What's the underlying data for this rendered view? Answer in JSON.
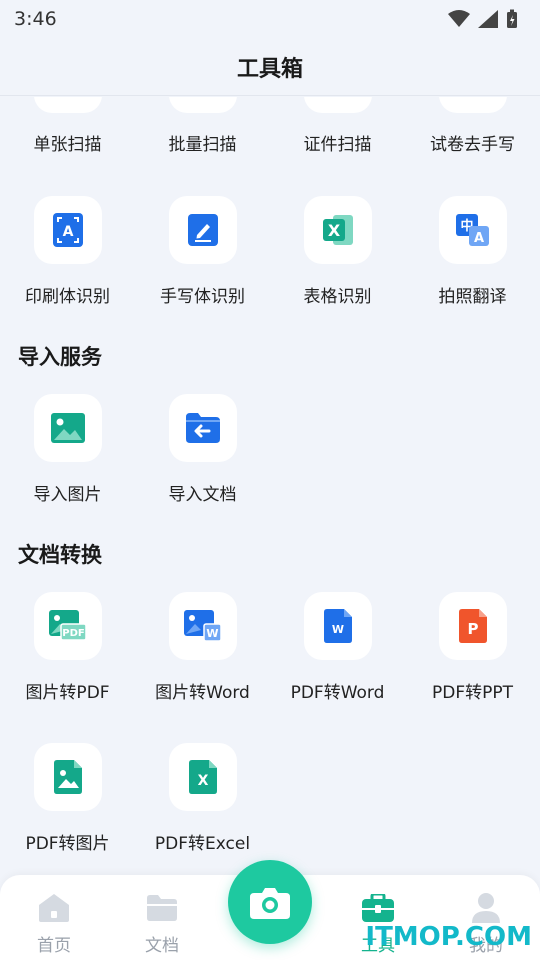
{
  "status_bar": {
    "time": "3:46"
  },
  "header": {
    "title": "工具箱"
  },
  "scan_row": [
    {
      "label": "单张扫描"
    },
    {
      "label": "批量扫描"
    },
    {
      "label": "证件扫描"
    },
    {
      "label": "试卷去手写"
    }
  ],
  "recognize_row": [
    {
      "label": "印刷体识别",
      "icon": "print-text-icon"
    },
    {
      "label": "手写体识别",
      "icon": "handwriting-icon"
    },
    {
      "label": "表格识别",
      "icon": "excel-icon"
    },
    {
      "label": "拍照翻译",
      "icon": "translate-icon"
    }
  ],
  "import_section": {
    "title": "导入服务",
    "items": [
      {
        "label": "导入图片",
        "icon": "image-icon"
      },
      {
        "label": "导入文档",
        "icon": "folder-import-icon"
      }
    ]
  },
  "convert_section": {
    "title": "文档转换",
    "items": [
      {
        "label": "图片转PDF",
        "icon": "image-to-pdf-icon"
      },
      {
        "label": "图片转Word",
        "icon": "image-to-word-icon"
      },
      {
        "label": "PDF转Word",
        "icon": "word-icon"
      },
      {
        "label": "PDF转PPT",
        "icon": "ppt-icon"
      },
      {
        "label": "PDF转图片",
        "icon": "pdf-to-image-icon"
      },
      {
        "label": "PDF转Excel",
        "icon": "pdf-to-excel-icon"
      }
    ]
  },
  "tab_bar": {
    "home": "首页",
    "docs": "文档",
    "tools": "工具",
    "mine": "我的",
    "active": "tools"
  },
  "watermark": "ITMOP.COM",
  "colors": {
    "accent": "#1ec9a0",
    "blue": "#1f6fe8",
    "teal": "#14a88a",
    "orange": "#f0552c",
    "background": "#f1f4fa"
  }
}
